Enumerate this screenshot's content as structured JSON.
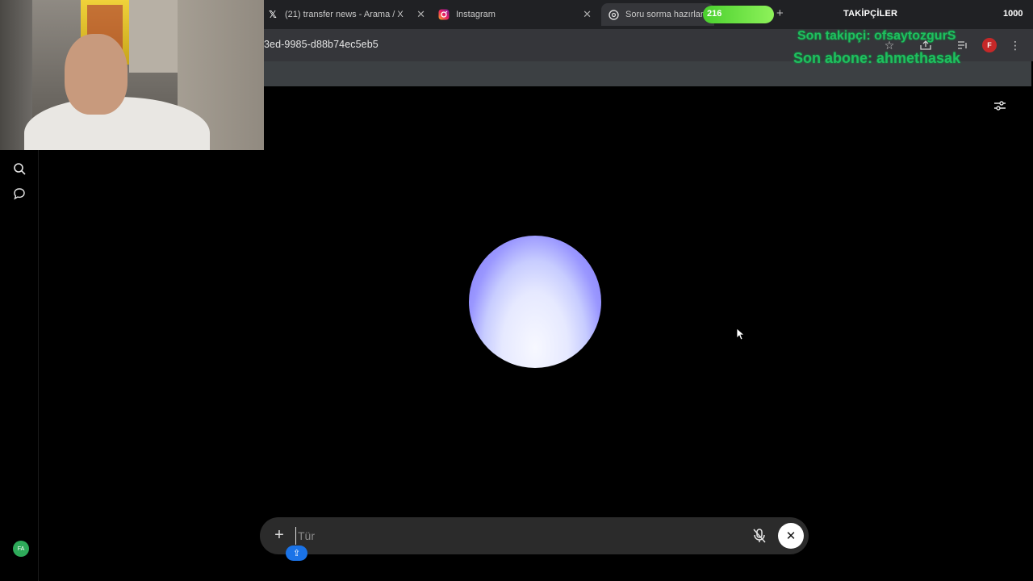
{
  "browser": {
    "tabs": [
      {
        "label": "(21) transfer news - Arama / X",
        "icon": "x-logo-icon"
      },
      {
        "label": "Instagram",
        "icon": "instagram-icon"
      },
      {
        "label": "Soru sorma hazırlan",
        "icon": "openai-icon"
      }
    ],
    "url": "3ed-9985-d88b74ec5eb5",
    "profile_initial": "F"
  },
  "overlay": {
    "follow_count": "216",
    "goal_label": "TAKİPÇİLER",
    "goal_target": "1000",
    "last_follower": "Son takipçi: ofsaytozgurS",
    "last_subscriber": "Son abone: ahmethasak"
  },
  "sidebar": {
    "items": [
      {
        "icon": "search-icon"
      },
      {
        "icon": "chat-bubble-icon"
      }
    ],
    "avatar_initials": "FA"
  },
  "composer": {
    "placeholder": "Tür",
    "value": ""
  },
  "colors": {
    "orb_top": "#7c74f6",
    "orb_bottom": "#f7f8ff",
    "progress_green": "#4ad02e",
    "overlay_text_green": "#1fbf5e",
    "badge_blue": "#1a73e8"
  }
}
